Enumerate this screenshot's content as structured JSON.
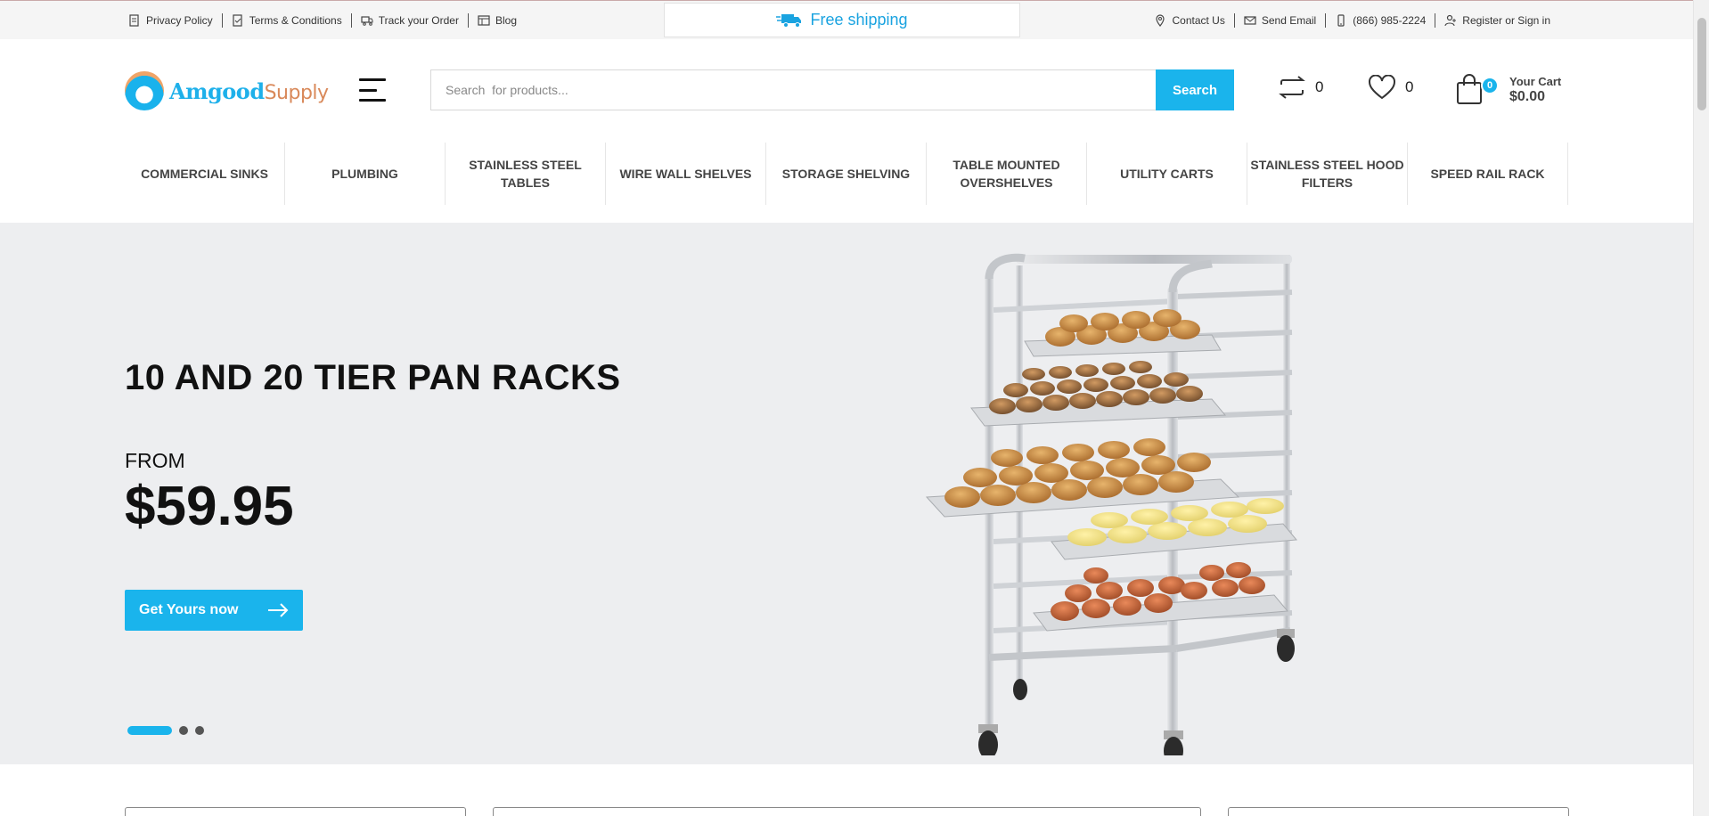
{
  "topbar": {
    "left_links": [
      {
        "label": "Privacy Policy",
        "icon": "document-icon"
      },
      {
        "label": "Terms & Conditions",
        "icon": "document-check-icon"
      },
      {
        "label": "Track your Order",
        "icon": "truck-icon"
      },
      {
        "label": "Blog",
        "icon": "grid-icon"
      }
    ],
    "free_shipping": "Free shipping",
    "right_links": [
      {
        "label": "Contact Us",
        "icon": "location-pin-icon"
      },
      {
        "label": "Send Email",
        "icon": "envelope-icon"
      },
      {
        "label": "(866) 985-2224",
        "icon": "phone-icon"
      },
      {
        "label": "Register or Sign in",
        "icon": "user-add-icon"
      }
    ]
  },
  "header": {
    "logo": {
      "brand": "Amgood",
      "suffix": "Supply"
    },
    "search": {
      "placeholder": "Search  for products...",
      "button": "Search"
    },
    "compare_count": "0",
    "wishlist_count": "0",
    "cart": {
      "count": "0",
      "label": "Your Cart",
      "total": "$0.00"
    }
  },
  "categories": [
    "COMMERCIAL SINKS",
    "PLUMBING",
    "STAINLESS STEEL TABLES",
    "WIRE WALL SHELVES",
    "STORAGE SHELVING",
    "TABLE MOUNTED OVERSHELVES",
    "UTILITY CARTS",
    "STAINLESS STEEL HOOD FILTERS",
    "SPEED RAIL RACK"
  ],
  "hero": {
    "title": "10 AND 20 TIER PAN RACKS",
    "from": "FROM",
    "price": "$59.95",
    "cta": "Get Yours now",
    "slides": 3,
    "active_slide": 1
  },
  "colors": {
    "accent": "#1ab4ec",
    "hero_bg": "#edeef0",
    "topbar_bg": "#f5f5f5"
  }
}
